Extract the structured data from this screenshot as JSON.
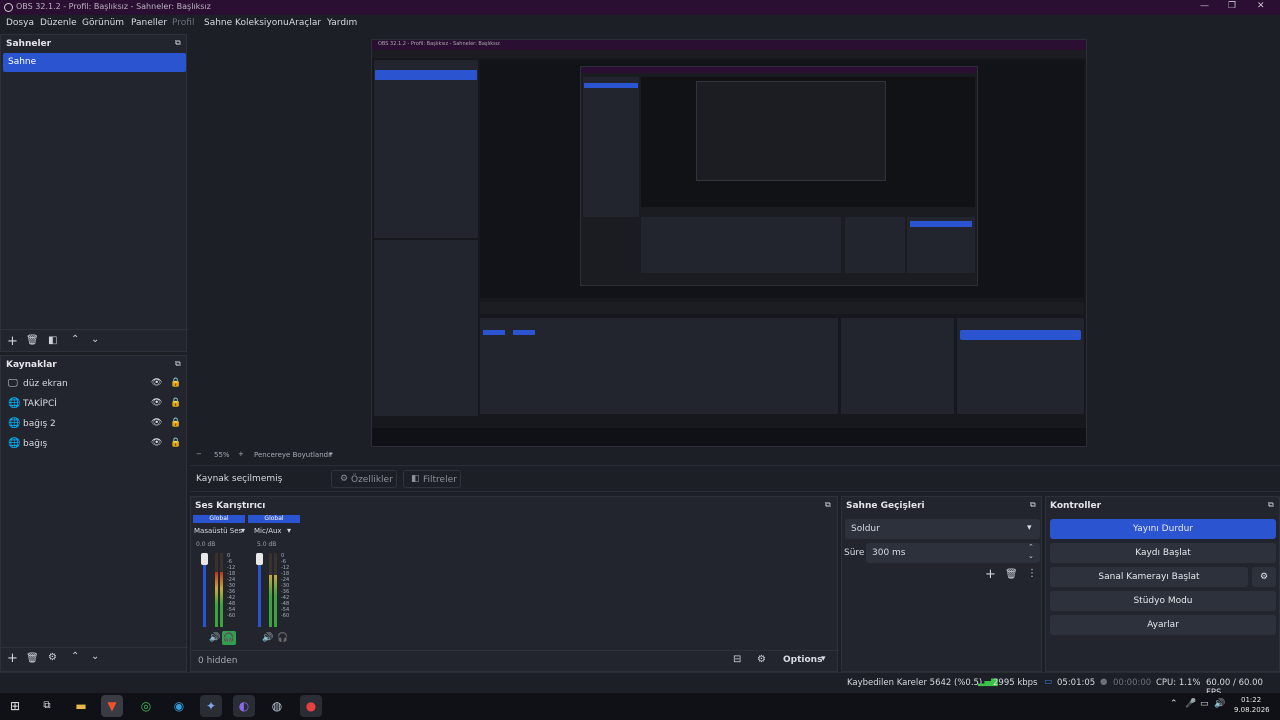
{
  "window": {
    "title": "OBS 32.1.2 - Profil: Başlıksız - Sahneler: Başlıksız",
    "controls": [
      "—",
      "❐",
      "✕"
    ]
  },
  "menu": [
    {
      "label": "Dosya",
      "enabled": true
    },
    {
      "label": "Düzenle",
      "enabled": true
    },
    {
      "label": "Görünüm",
      "enabled": true
    },
    {
      "label": "Paneller",
      "enabled": true
    },
    {
      "label": "Profil",
      "enabled": false
    },
    {
      "label": "Sahne Koleksiyonu",
      "enabled": true
    },
    {
      "label": "Araçlar",
      "enabled": true
    },
    {
      "label": "Yardım",
      "enabled": true
    }
  ],
  "scenes": {
    "title": "Sahneler",
    "items": [
      "Sahne"
    ],
    "selected": 0
  },
  "sources": {
    "title": "Kaynaklar",
    "items": [
      {
        "name": "düz ekran",
        "icon": "monitor-icon"
      },
      {
        "name": "TAKİPCİ",
        "icon": "globe-icon"
      },
      {
        "name": "bağış 2",
        "icon": "globe-icon"
      },
      {
        "name": "bağış",
        "icon": "globe-icon"
      }
    ]
  },
  "preview": {
    "zoom": "55%",
    "fit_mode": "Pencereye Boyutlandır",
    "inner_window_title": "OBS 32.1.2 - Profil: Başlıksız - Sahneler: Başlıksız"
  },
  "properties_bar": {
    "no_source": "Kaynak seçilmemiş",
    "properties": "Özellikler",
    "filters": "Filtreler"
  },
  "audio_mixer": {
    "title": "Ses Karıştırıcı",
    "channels": [
      {
        "global": "Global",
        "name": "Masaüstü Ses",
        "db": "0.0 dB",
        "level": 0.74
      },
      {
        "global": "Global",
        "name": "Mic/Aux",
        "db": "5.0 dB",
        "level": 0.7
      }
    ],
    "ticks": [
      "0",
      "-6",
      "-12",
      "-18",
      "-24",
      "-30",
      "-36",
      "-42",
      "-48",
      "-54",
      "-60"
    ],
    "hidden": "0 hidden",
    "options": "Options"
  },
  "transitions": {
    "title": "Sahne Geçişleri",
    "selected": "Soldur",
    "duration_label": "Süre",
    "duration": "300 ms"
  },
  "controls": {
    "title": "Kontroller",
    "stop_stream": "Yayını Durdur",
    "start_record": "Kaydı Başlat",
    "virtual_cam": "Sanal Kamerayı Başlat",
    "studio_mode": "Stüdyo Modu",
    "settings": "Ayarlar"
  },
  "status": {
    "dropped": "Kaybedilen Kareler 5642 (%0.5)",
    "bitrate": "2995 kbps",
    "stream_time": "05:01:05",
    "record_time": "00:00:00",
    "cpu": "CPU: 1.1%",
    "fps": "60.00 / 60.00 FPS"
  },
  "taskbar": {
    "time": "01:22",
    "date": "9.08.2026"
  },
  "colors": {
    "accent": "#2b54d0",
    "titlebar": "#2a0f33",
    "bg": "#1d1f26",
    "panel": "#22252d"
  }
}
